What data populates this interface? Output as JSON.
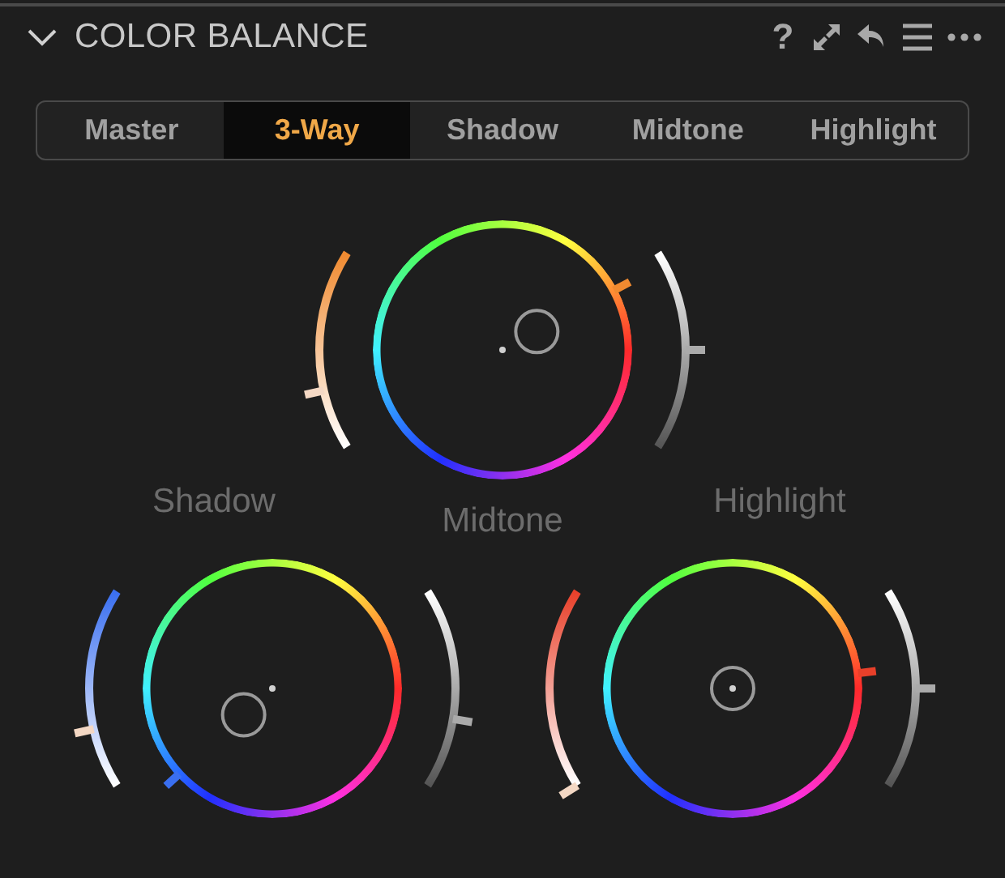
{
  "panel": {
    "title": "COLOR BALANCE",
    "expanded": true,
    "help": "?"
  },
  "tabs": [
    {
      "label": "Master",
      "selected": false
    },
    {
      "label": "3-Way",
      "selected": true
    },
    {
      "label": "Shadow",
      "selected": false
    },
    {
      "label": "Midtone",
      "selected": false
    },
    {
      "label": "Highlight",
      "selected": false
    }
  ],
  "wheels": [
    {
      "kind": "top",
      "label": "Midtone",
      "color": "#f08a30"
    },
    {
      "kind": "left",
      "label": "Shadow",
      "color": "#3a6ff0"
    },
    {
      "kind": "right",
      "label": "Highlight",
      "color": "#e8402a"
    }
  ]
}
